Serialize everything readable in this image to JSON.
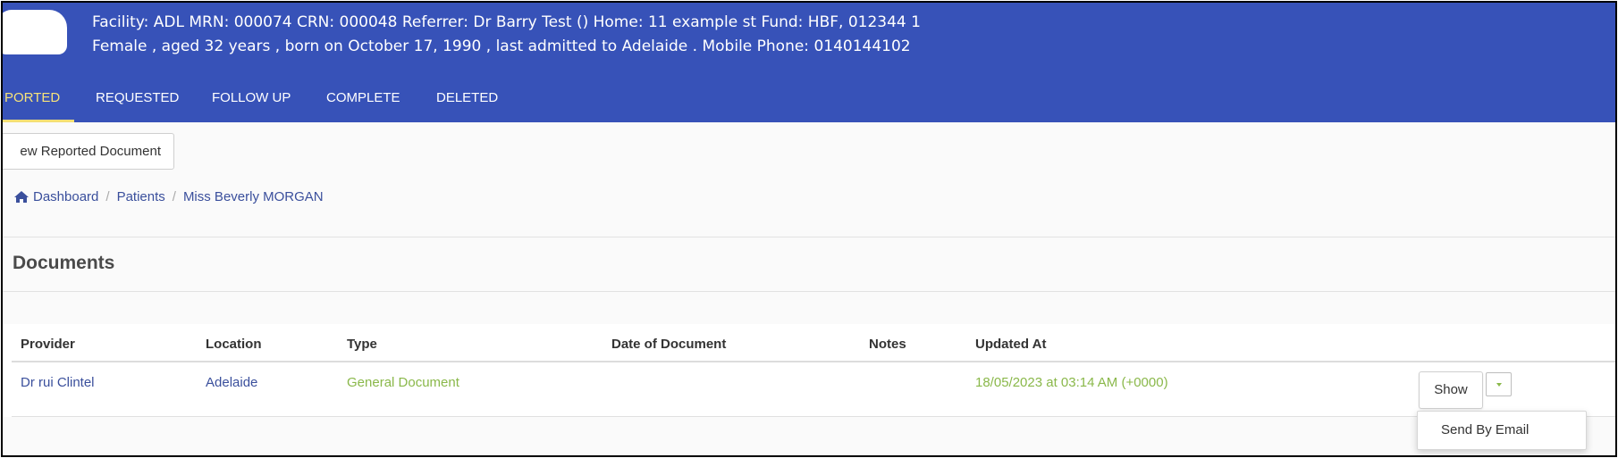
{
  "patient_header": {
    "line1": "Facility: ADL   MRN: 000074   CRN: 000048   Referrer: Dr Barry Test ()   Home: 11 example st   Fund: HBF, 012344 1",
    "line2": "Female , aged 32 years , born on October 17, 1990 , last admitted to Adelaide . Mobile Phone: 0140144102"
  },
  "tabs": [
    {
      "label": "PORTED",
      "active": true
    },
    {
      "label": "REQUESTED",
      "active": false
    },
    {
      "label": "FOLLOW UP",
      "active": false
    },
    {
      "label": "COMPLETE",
      "active": false
    },
    {
      "label": "DELETED",
      "active": false
    }
  ],
  "new_document_button": "ew Reported Document",
  "breadcrumb": {
    "items": [
      "Dashboard",
      "Patients",
      "Miss Beverly MORGAN"
    ],
    "separator": "/"
  },
  "section_title": "Documents",
  "table": {
    "columns": [
      "Provider",
      "Location",
      "Type",
      "Date of Document",
      "Notes",
      "Updated At"
    ],
    "rows": [
      {
        "provider": "Dr rui Clintel",
        "location": "Adelaide",
        "type": "General Document",
        "date_of_document": "",
        "notes": "",
        "updated_at": "18/05/2023 at 03:14 AM (+0000)"
      }
    ]
  },
  "row_actions": {
    "show_label": "Show",
    "dropdown_items": [
      "Send By Email"
    ]
  },
  "icons": {
    "home": "home-icon",
    "caret": "caret-down-icon"
  },
  "colors": {
    "header_bg": "#3752b8",
    "active_tab": "#f7e37a",
    "link": "#3a4f9c",
    "green_text": "#8ab84a"
  }
}
